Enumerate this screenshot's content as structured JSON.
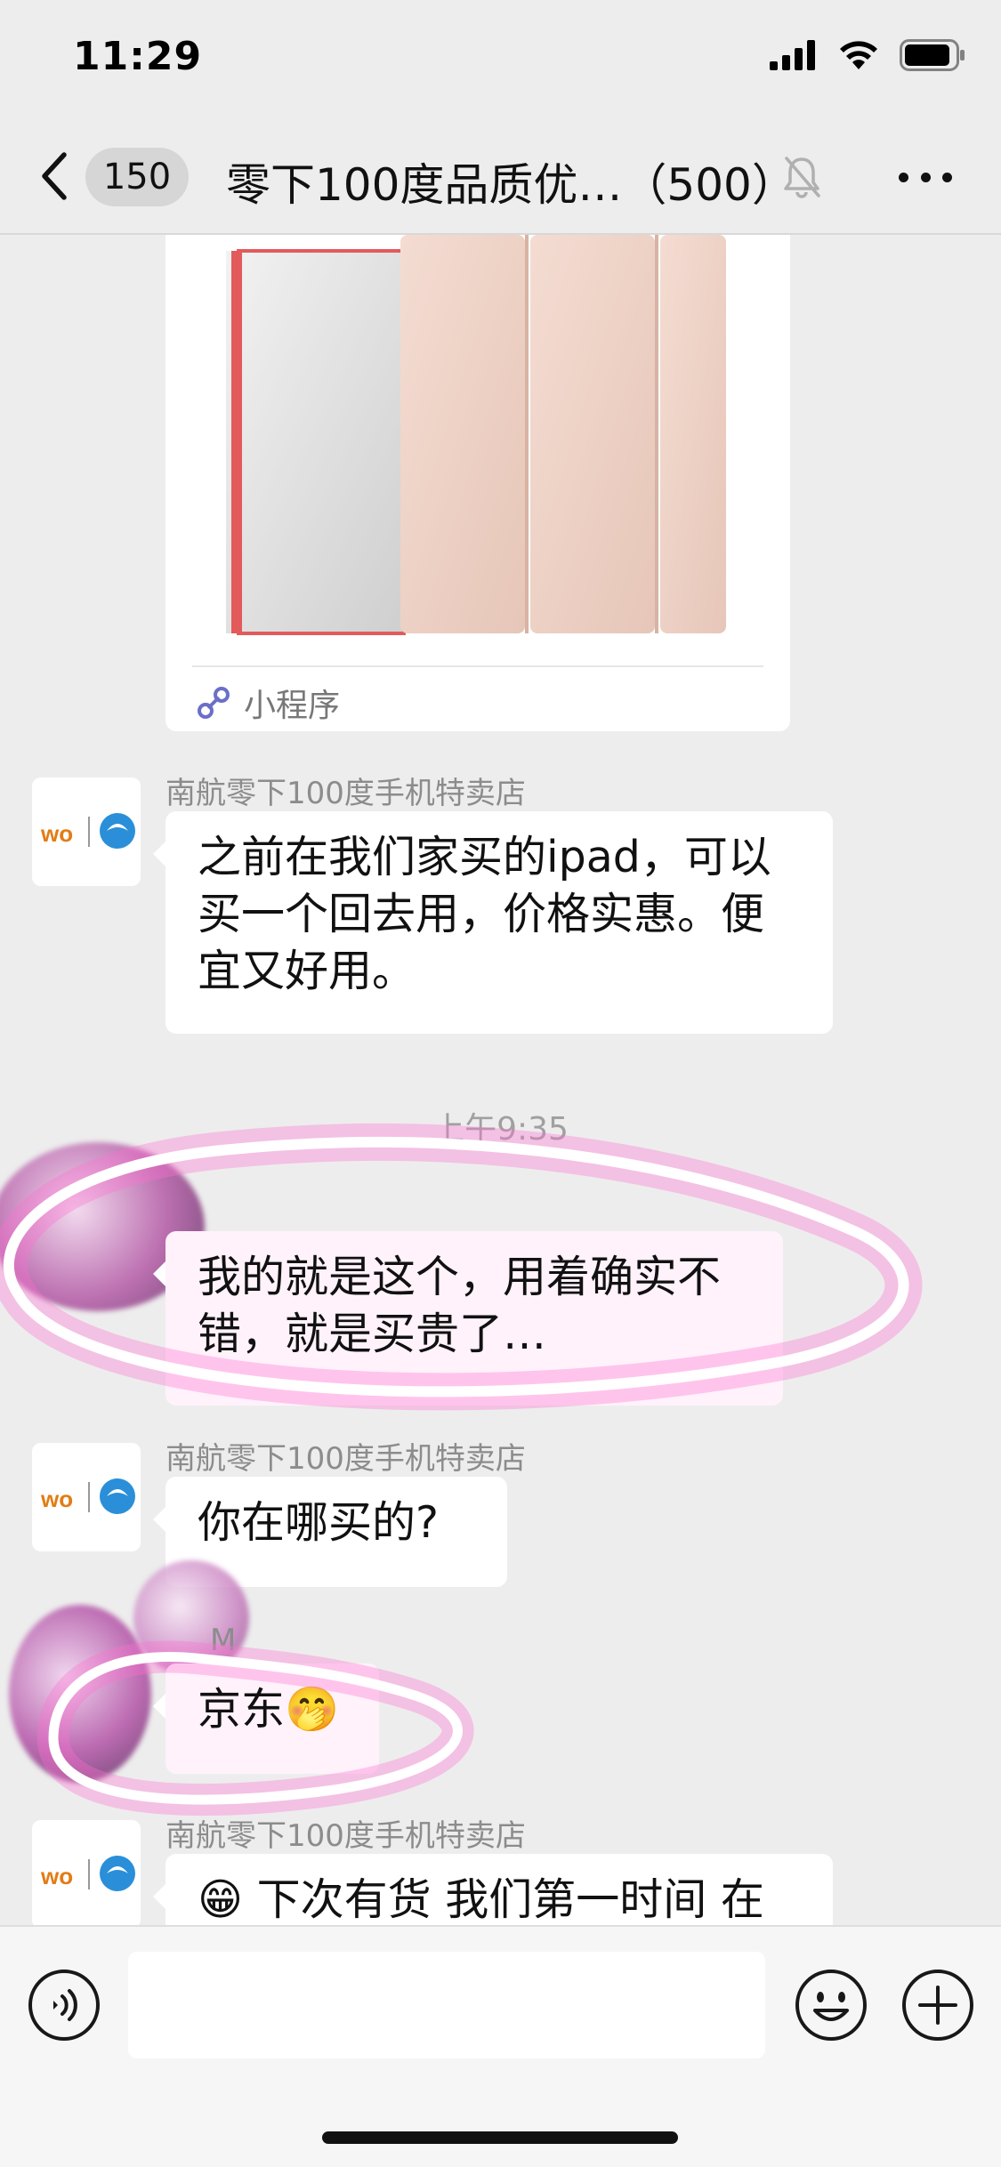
{
  "status_bar": {
    "time": "11:29"
  },
  "nav": {
    "unread_count": "150",
    "chat_title": "零下100度品质优…（500）"
  },
  "messages": {
    "mini_program_label": "小程序",
    "sender_1": "南航零下100度手机特卖店",
    "msg_1": "之前在我们家买的ipad，可以买一个回去用，价格实惠。便宜又好用。",
    "timestamp": "上午9:35",
    "msg_2": "我的就是这个，用着确实不错，就是买贵了…",
    "sender_2": "南航零下100度手机特卖店",
    "msg_3": "你在哪买的?",
    "sender_self_fragment": "M",
    "msg_4": "京东",
    "msg_4_emoji": "🤭",
    "sender_3": "南航零下100度手机特卖店",
    "msg_5_emoji": "😁",
    "msg_5": "下次有货 我们第一时间 在"
  },
  "input_bar": {
    "text_value": ""
  },
  "icons": {
    "back": "chevron-left-icon",
    "mute": "bell-slash-icon",
    "more": "more-dots-icon",
    "voice": "voice-icon",
    "emoji": "emoji-smile-icon",
    "plus": "plus-circle-icon",
    "mini_program": "link-icon"
  },
  "colors": {
    "background": "#ededed",
    "bubble": "#ffffff",
    "highlight_pink": "#e84fb5"
  }
}
